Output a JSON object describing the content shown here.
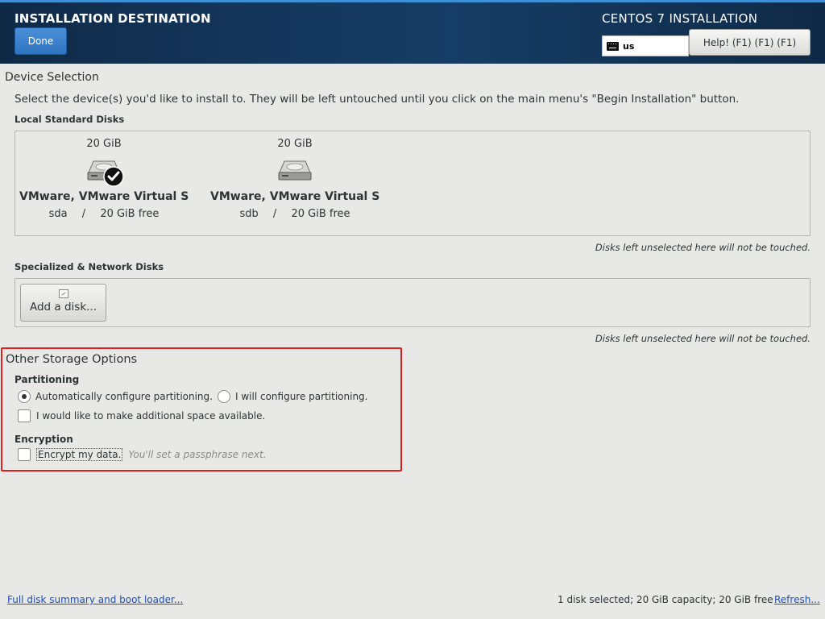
{
  "header": {
    "title": "INSTALLATION DESTINATION",
    "done_label": "Done",
    "product_title": "CENTOS 7 INSTALLATION",
    "keyboard_layout": "us",
    "help_label": "Help! (F1) (F1) (F1)"
  },
  "device_selection": {
    "title": "Device Selection",
    "instruction": "Select the device(s) you'd like to install to.  They will be left untouched until you click on the main menu's \"Begin Installation\" button.",
    "local_label": "Local Standard Disks",
    "disks": [
      {
        "size": "20 GiB",
        "name": "VMware, VMware Virtual S",
        "device": "sda",
        "separator": "/",
        "free": "20 GiB free",
        "selected": true
      },
      {
        "size": "20 GiB",
        "name": "VMware, VMware Virtual S",
        "device": "sdb",
        "separator": "/",
        "free": "20 GiB free",
        "selected": false
      }
    ],
    "local_note": "Disks left unselected here will not be touched.",
    "specialized_label": "Specialized & Network Disks",
    "add_disk_label": "Add a disk...",
    "specialized_note": "Disks left unselected here will not be touched."
  },
  "other_storage": {
    "title": "Other Storage Options",
    "partitioning_label": "Partitioning",
    "auto_partition_label": "Automatically configure partitioning.",
    "manual_partition_label": "I will configure partitioning.",
    "auto_selected": true,
    "additional_space_label": "I would like to make additional space available.",
    "additional_space_checked": false,
    "encryption_label": "Encryption",
    "encrypt_label": "Encrypt my data.",
    "encrypt_hint": "You'll set a passphrase next.",
    "encrypt_checked": false
  },
  "footer": {
    "summary_link": "Full disk summary and boot loader...",
    "status": "1 disk selected; 20 GiB capacity; 20 GiB free",
    "refresh_link": "Refresh..."
  },
  "colors": {
    "header_bg": "#14355a",
    "accent": "#3d8fd6",
    "done_button": "#2f74c0",
    "highlight_border": "#e02020",
    "link": "#1d4fb3"
  }
}
